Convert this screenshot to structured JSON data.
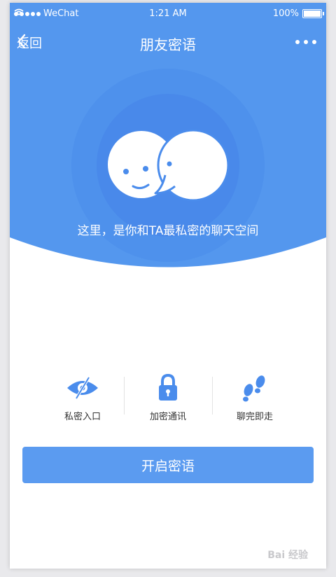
{
  "status_bar": {
    "carrier": "WeChat",
    "time": "1:21 AM",
    "battery": "100%"
  },
  "nav": {
    "back_label": "返回",
    "title": "朋友密语"
  },
  "hero": {
    "tagline": "这里，是你和TA最私密的聊天空间"
  },
  "features": [
    {
      "label": "私密入口",
      "icon": "hidden-eye-icon"
    },
    {
      "label": "加密通讯",
      "icon": "lock-icon"
    },
    {
      "label": "聊完即走",
      "icon": "footprints-icon"
    }
  ],
  "action": {
    "button_label": "开启密语"
  },
  "watermark": "Bai 经验",
  "colors": {
    "primary": "#5497ee",
    "button": "#5b9bf0",
    "icon": "#4a8cec"
  }
}
